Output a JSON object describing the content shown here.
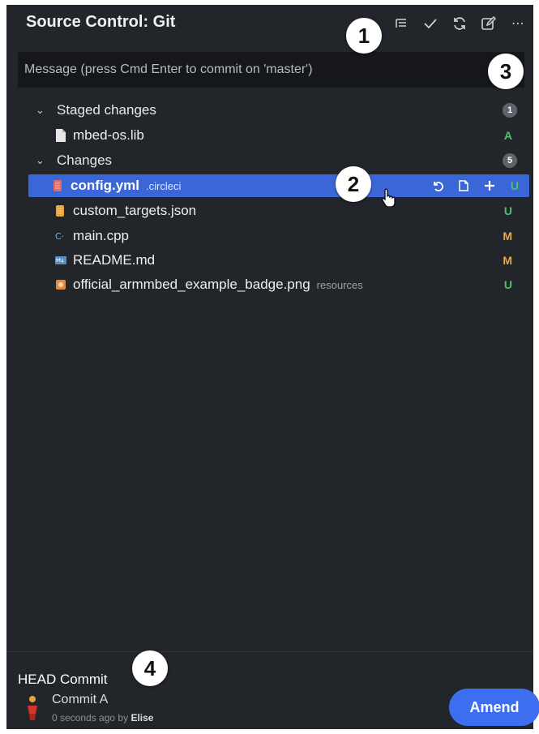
{
  "panel": {
    "title": "Source Control: Git",
    "toolbar_icons": [
      "tree-view-icon",
      "checkmark-icon",
      "refresh-icon",
      "edit-icon",
      "more-icon"
    ]
  },
  "message": {
    "placeholder": "Message (press Cmd Enter to commit on 'master')"
  },
  "staged": {
    "label": "Staged changes",
    "count": "1",
    "files": [
      {
        "name": "mbed-os.lib",
        "dir": "",
        "status": "A",
        "icon": "file-icon"
      }
    ]
  },
  "changes": {
    "label": "Changes",
    "count": "5",
    "files": [
      {
        "name": "config.yml",
        "dir": ".circleci",
        "status": "U",
        "icon": "yaml-file-icon",
        "selected": true
      },
      {
        "name": "custom_targets.json",
        "dir": "",
        "status": "U",
        "icon": "json-file-icon"
      },
      {
        "name": "main.cpp",
        "dir": "",
        "status": "M",
        "icon": "cpp-file-icon"
      },
      {
        "name": "README.md",
        "dir": "",
        "status": "M",
        "icon": "markdown-file-icon"
      },
      {
        "name": "official_armmbed_example_badge.png",
        "dir": "resources",
        "status": "U",
        "icon": "image-file-icon"
      }
    ]
  },
  "callouts": [
    "1",
    "2",
    "3",
    "4"
  ],
  "head_commit": {
    "section_title": "HEAD Commit",
    "commit_name": "Commit A",
    "time": "0 seconds ago",
    "by": "by",
    "author": "Elise",
    "amend_label": "Amend"
  },
  "colors": {
    "panel_bg": "#22252a",
    "selected_bg": "#3a66d8",
    "status_added": "#4ec26b",
    "status_untracked": "#4ec26b",
    "status_modified": "#e7a84a",
    "amend_bg": "#3d6ef0"
  }
}
